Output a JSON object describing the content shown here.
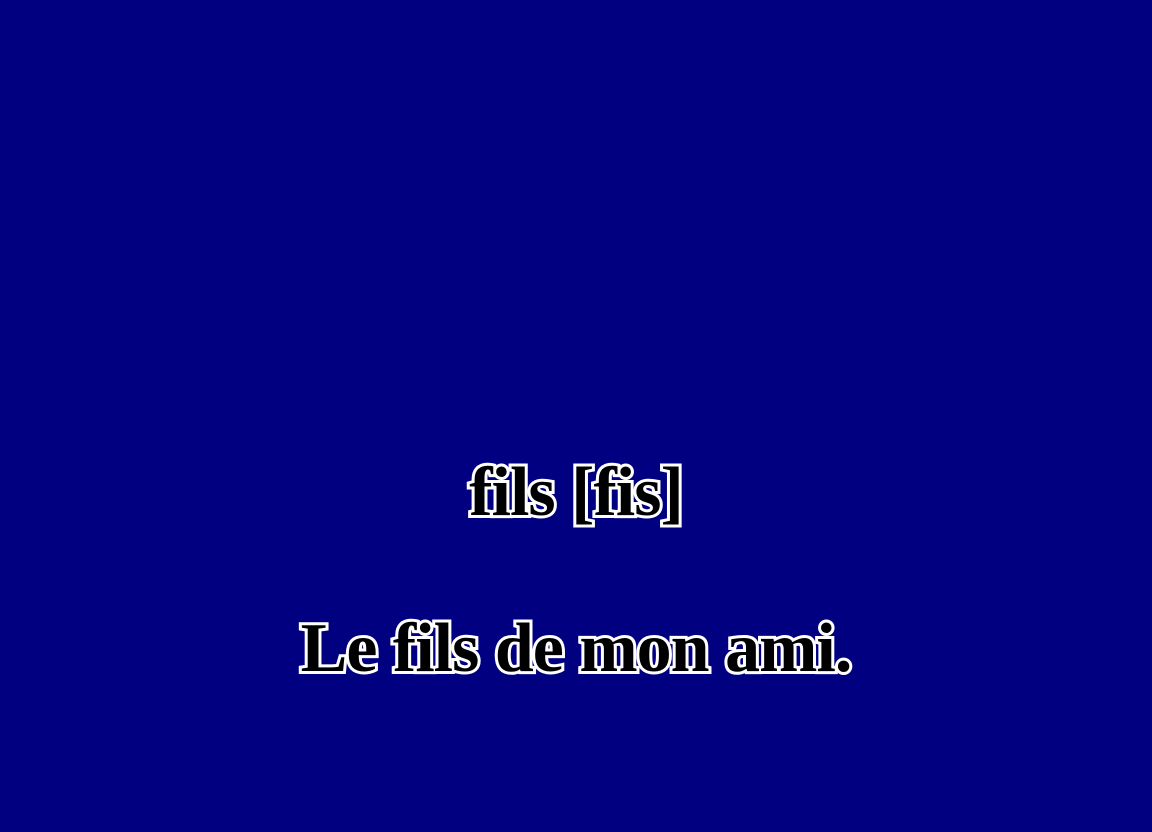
{
  "slide": {
    "word": "fils [fis]",
    "sentence": "Le fils de mon ami."
  },
  "colors": {
    "background": "#000080",
    "text_fill": "#000000",
    "text_outline": "#ffffff"
  }
}
